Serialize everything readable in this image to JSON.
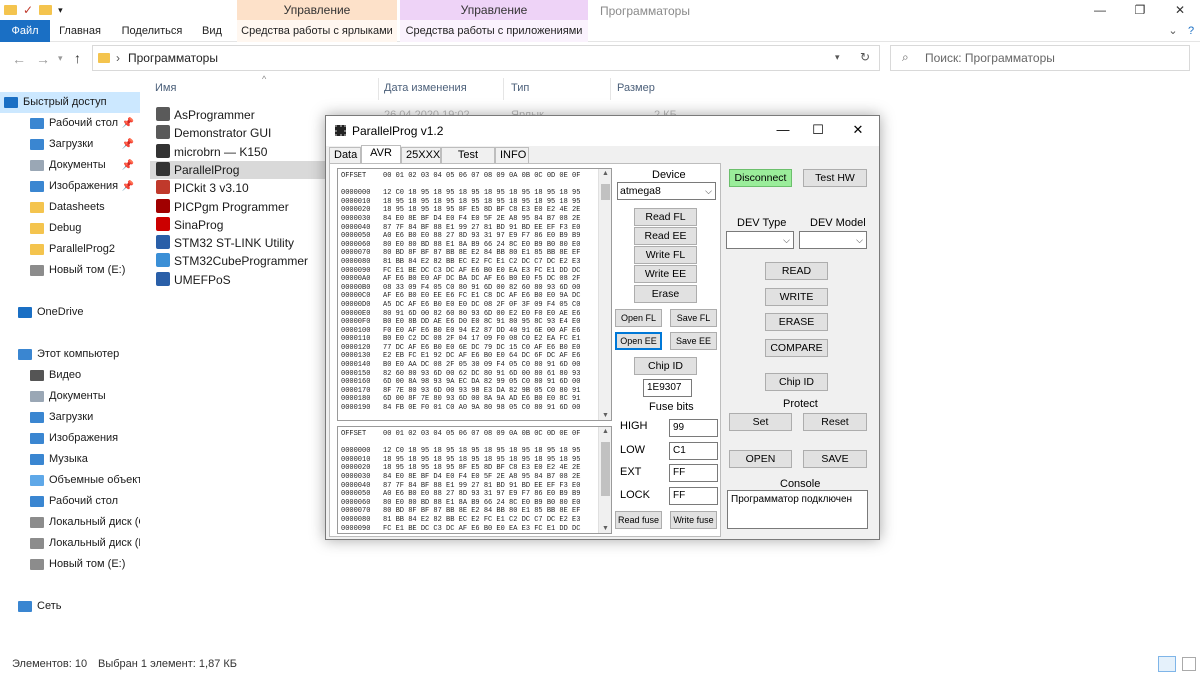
{
  "explorer": {
    "context_tab1": "Управление",
    "context_tab2": "Управление",
    "window_title": "Программаторы",
    "ribbon_tabs": {
      "file": "Файл",
      "home": "Главная",
      "share": "Поделиться",
      "view": "Вид",
      "shortcut_tools": "Средства работы с ярлыками",
      "app_tools": "Средства работы с приложениями"
    },
    "address": {
      "chevron": "›",
      "path": "Программаторы"
    },
    "search_placeholder": "Поиск: Программаторы",
    "columns": {
      "name": "Имя",
      "date": "Дата изменения",
      "type": "Тип",
      "size": "Размер"
    },
    "first_row_partial": {
      "date": "26.04.2020 19:02",
      "type": "Ярлык",
      "size": "2 КБ"
    },
    "files": [
      {
        "name": "AsProgrammer",
        "icon": "gear-icon",
        "color": "#5a5a5a"
      },
      {
        "name": "Demonstrator GUI",
        "icon": "gear-icon",
        "color": "#5a5a5a"
      },
      {
        "name": "microbrn — K150",
        "icon": "chip-icon",
        "color": "#333333"
      },
      {
        "name": "ParallelProg",
        "icon": "chip-icon",
        "color": "#333333"
      },
      {
        "name": "PICkit 3 v3.10",
        "icon": "pickit-icon",
        "color": "#c0392b"
      },
      {
        "name": "PICPgm Programmer",
        "icon": "chip-icon",
        "color": "#a00000"
      },
      {
        "name": "SinaProg",
        "icon": "sina-icon",
        "color": "#cc0000"
      },
      {
        "name": "STM32 ST-LINK Utility",
        "icon": "stlink-icon",
        "color": "#2a5fa8"
      },
      {
        "name": "STM32CubeProgrammer",
        "icon": "cube-icon",
        "color": "#3b8fd6"
      },
      {
        "name": "UMEFPoS",
        "icon": "app-icon",
        "color": "#2a5fa8"
      }
    ],
    "sidebar": [
      {
        "label": "Быстрый доступ",
        "icon": "star-icon",
        "color": "#1a6fc4",
        "indent": 4,
        "pinned": false,
        "selected": true
      },
      {
        "label": "Рабочий стол",
        "icon": "desktop-icon",
        "color": "#3a86d1",
        "indent": 30,
        "pinned": true,
        "selected": false
      },
      {
        "label": "Загрузки",
        "icon": "download-icon",
        "color": "#3a86d1",
        "indent": 30,
        "pinned": true,
        "selected": false
      },
      {
        "label": "Документы",
        "icon": "document-icon",
        "color": "#9aa7b5",
        "indent": 30,
        "pinned": true,
        "selected": false
      },
      {
        "label": "Изображения",
        "icon": "pictures-icon",
        "color": "#3a86d1",
        "indent": 30,
        "pinned": true,
        "selected": false
      },
      {
        "label": "Datasheets",
        "icon": "folder-icon",
        "color": "#f4c44e",
        "indent": 30,
        "pinned": false,
        "selected": false
      },
      {
        "label": "Debug",
        "icon": "folder-icon",
        "color": "#f4c44e",
        "indent": 30,
        "pinned": false,
        "selected": false
      },
      {
        "label": "ParallelProg2",
        "icon": "folder-icon",
        "color": "#f4c44e",
        "indent": 30,
        "pinned": false,
        "selected": false
      },
      {
        "label": "Новый том (E:)",
        "icon": "drive-icon",
        "color": "#8c8c8c",
        "indent": 30,
        "pinned": false,
        "selected": false
      },
      {
        "label": "",
        "icon": "",
        "color": "",
        "indent": 0,
        "pinned": false,
        "selected": false
      },
      {
        "label": "OneDrive",
        "icon": "cloud-icon",
        "color": "#1a6fc4",
        "indent": 18,
        "pinned": false,
        "selected": false
      },
      {
        "label": "",
        "icon": "",
        "color": "",
        "indent": 0,
        "pinned": false,
        "selected": false
      },
      {
        "label": "Этот компьютер",
        "icon": "computer-icon",
        "color": "#3a86d1",
        "indent": 18,
        "pinned": false,
        "selected": false
      },
      {
        "label": "Видео",
        "icon": "video-icon",
        "color": "#555555",
        "indent": 30,
        "pinned": false,
        "selected": false
      },
      {
        "label": "Документы",
        "icon": "document-icon",
        "color": "#9aa7b5",
        "indent": 30,
        "pinned": false,
        "selected": false
      },
      {
        "label": "Загрузки",
        "icon": "download-icon",
        "color": "#3a86d1",
        "indent": 30,
        "pinned": false,
        "selected": false
      },
      {
        "label": "Изображения",
        "icon": "pictures-icon",
        "color": "#3a86d1",
        "indent": 30,
        "pinned": false,
        "selected": false
      },
      {
        "label": "Музыка",
        "icon": "music-icon",
        "color": "#3a86d1",
        "indent": 30,
        "pinned": false,
        "selected": false
      },
      {
        "label": "Объемные объекты",
        "icon": "cube-icon",
        "color": "#5fa8e8",
        "indent": 30,
        "pinned": false,
        "selected": false
      },
      {
        "label": "Рабочий стол",
        "icon": "desktop-icon",
        "color": "#3a86d1",
        "indent": 30,
        "pinned": false,
        "selected": false
      },
      {
        "label": "Локальный диск (C",
        "icon": "drive-icon",
        "color": "#8c8c8c",
        "indent": 30,
        "pinned": false,
        "selected": false
      },
      {
        "label": "Локальный диск (D",
        "icon": "drive-icon",
        "color": "#8c8c8c",
        "indent": 30,
        "pinned": false,
        "selected": false
      },
      {
        "label": "Новый том (E:)",
        "icon": "drive-icon",
        "color": "#8c8c8c",
        "indent": 30,
        "pinned": false,
        "selected": false
      },
      {
        "label": "",
        "icon": "",
        "color": "",
        "indent": 0,
        "pinned": false,
        "selected": false
      },
      {
        "label": "Сеть",
        "icon": "network-icon",
        "color": "#3a86d1",
        "indent": 18,
        "pinned": false,
        "selected": false
      }
    ],
    "status": {
      "count": "Элементов: 10",
      "selection": "Выбран 1 элемент: 1,87 КБ"
    }
  },
  "pp": {
    "title": "ParallelProg v1.2",
    "tabs": [
      "Data",
      "AVR",
      "25XXX",
      "Test H/W",
      "INFO"
    ],
    "active_tab": "AVR",
    "hex_header": "OFFSET    00 01 02 03 04 05 06 07 08 09 0A 0B 0C 0D 0E 0F",
    "hex_rows": [
      "0000000   12 C0 18 95 18 95 18 95 18 95 18 95 18 95 18 95",
      "0000010   18 95 18 95 18 95 18 95 18 95 18 95 18 95 18 95",
      "0000020   18 95 18 95 18 95 8F E5 8D BF C8 E3 E0 E2 4E 2E",
      "0000030   84 E0 8E BF D4 E0 F4 E0 5F 2E A8 95 84 B7 08 2E",
      "0000040   87 7F 84 BF 88 E1 99 27 81 BD 91 BD EE EF F3 E0",
      "0000050   A0 E6 B0 E0 88 27 8D 93 31 97 E9 F7 86 E0 B9 B9",
      "0000060   80 E0 80 BD 88 E1 8A B9 66 24 8C E0 B9 B0 80 E0",
      "0000070   80 BD 8F BF 87 BB 8E E2 84 BB 80 E1 85 BB 8E EF",
      "0000080   81 BB 84 E2 82 BB EC E2 FC E1 C2 DC C7 DC E2 E3",
      "0000090   FC E1 BE DC C3 DC AF E6 B0 E0 EA E3 FC E1 DD DC",
      "00000A0   AF E6 B0 E0 AF DC BA DC AF E6 B0 E0 F5 DC 08 2F",
      "00000B0   08 33 09 F4 05 C0 80 91 6D 00 82 60 80 93 6D 00",
      "00000C0   AF E6 B0 E0 EE E6 FC E1 C8 DC AF E6 B0 E0 9A DC",
      "00000D0   A5 DC AF E6 B0 E0 E0 DC 08 2F 0F 3F 09 F4 05 C0",
      "00000E0   80 91 6D 00 82 60 80 93 6D 00 E2 E0 F0 E0 AE E6",
      "00000F0   B0 E0 8B DD AE E6 D0 E0 8C 91 80 95 8C 93 E4 E0",
      "0000100   F0 E0 AF E6 B0 E0 94 E2 87 DD 40 91 6E 00 AF E6",
      "0000110   B0 E0 C2 DC 08 2F 04 17 09 F0 08 C0 E2 EA FC E1",
      "0000120   77 DC AF E6 B0 E0 6E DC 79 DC 15 C0 AF E6 B0 E0",
      "0000130   E2 EB FC E1 92 DC AF E6 B0 E0 64 DC 6F DC AF E6",
      "0000140   B0 E0 AA DC 08 2F 05 30 09 F4 05 C0 80 91 6D 00",
      "0000150   82 60 80 93 6D 00 62 DC 80 91 6D 00 80 61 80 93",
      "0000160   6D 00 8A 98 93 9A EC DA 82 99 05 C0 80 91 6D 00",
      "0000170   8F 7E 80 93 6D 00 93 98 E3 DA 82 9B 05 C0 80 91",
      "0000180   6D 00 8F 7E 80 93 6D 00 8A 9A AD E6 B0 E0 8C 91",
      "0000190   84 FB 0E F0 01 C0 A0 9A 80 98 05 C0 80 91 6D 00"
    ],
    "device_label": "Device",
    "device_value": "atmega8",
    "btn_read_fl": "Read FL",
    "btn_read_ee": "Read EE",
    "btn_write_fl": "Write FL",
    "btn_write_ee": "Write EE",
    "btn_erase": "Erase",
    "btn_open_fl": "Open FL",
    "btn_save_fl": "Save FL",
    "btn_open_ee": "Open EE",
    "btn_save_ee": "Save EE",
    "btn_chip_id": "Chip ID",
    "chip_id_value": "1E9307",
    "fuse_bits_label": "Fuse bits",
    "fuse_high_label": "HIGH",
    "fuse_high_value": "99",
    "fuse_low_label": "LOW",
    "fuse_low_value": "C1",
    "fuse_ext_label": "EXT",
    "fuse_ext_value": "FF",
    "fuse_lock_label": "LOCK",
    "fuse_lock_value": "FF",
    "btn_read_fuse": "Read fuse",
    "btn_write_fuse": "Write fuse",
    "btn_disconnect": "Disconnect",
    "btn_test_hw": "Test HW",
    "dev_type_label": "DEV Type",
    "dev_model_label": "DEV Model",
    "btn_read": "READ",
    "btn_write": "WRITE",
    "btn_erase_big": "ERASE",
    "btn_compare": "COMPARE",
    "btn_chip_id_right": "Chip ID",
    "protect_label": "Protect",
    "btn_set": "Set",
    "btn_reset": "Reset",
    "btn_open": "OPEN",
    "btn_save": "SAVE",
    "console_label": "Console",
    "console_text": "Программатор подключен",
    "accent_connected": "#9aed9a"
  }
}
